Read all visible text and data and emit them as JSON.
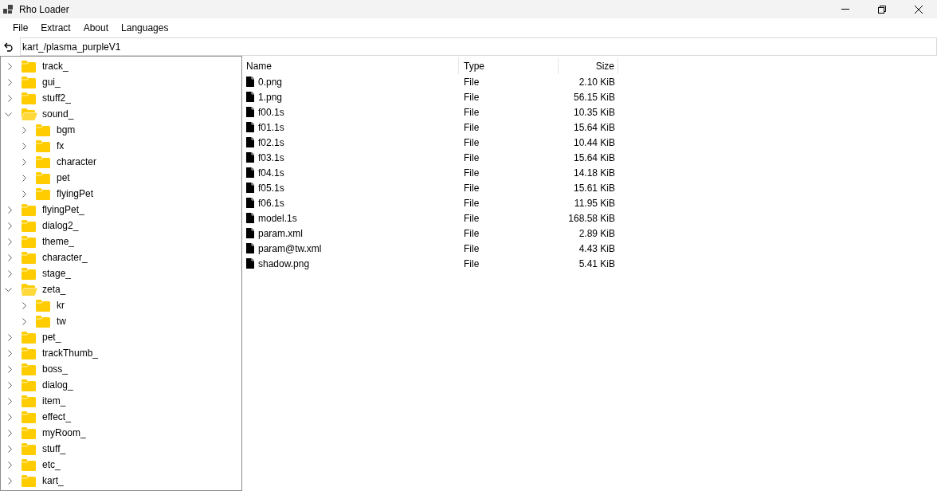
{
  "window": {
    "title": "Rho Loader"
  },
  "menu": [
    "File",
    "Extract",
    "About",
    "Languages"
  ],
  "path_field": {
    "value": "kart_/plasma_purpleV1"
  },
  "tree": [
    {
      "label": "track_",
      "expanded": false
    },
    {
      "label": "gui_",
      "expanded": false
    },
    {
      "label": "stuff2_",
      "expanded": false
    },
    {
      "label": "sound_",
      "expanded": true,
      "children": [
        {
          "label": "bgm",
          "expanded": false
        },
        {
          "label": "fx",
          "expanded": false
        },
        {
          "label": "character",
          "expanded": false
        },
        {
          "label": "pet",
          "expanded": false
        },
        {
          "label": "flyingPet",
          "expanded": false
        }
      ]
    },
    {
      "label": "flyingPet_",
      "expanded": false
    },
    {
      "label": "dialog2_",
      "expanded": false
    },
    {
      "label": "theme_",
      "expanded": false
    },
    {
      "label": "character_",
      "expanded": false
    },
    {
      "label": "stage_",
      "expanded": false
    },
    {
      "label": "zeta_",
      "expanded": true,
      "children": [
        {
          "label": "kr",
          "expanded": false
        },
        {
          "label": "tw",
          "expanded": false
        }
      ]
    },
    {
      "label": "pet_",
      "expanded": false
    },
    {
      "label": "trackThumb_",
      "expanded": false
    },
    {
      "label": "boss_",
      "expanded": false
    },
    {
      "label": "dialog_",
      "expanded": false
    },
    {
      "label": "item_",
      "expanded": false
    },
    {
      "label": "effect_",
      "expanded": false
    },
    {
      "label": "myRoom_",
      "expanded": false
    },
    {
      "label": "stuff_",
      "expanded": false
    },
    {
      "label": "etc_",
      "expanded": false
    },
    {
      "label": "kart_",
      "expanded": false
    }
  ],
  "table": {
    "columns": [
      "Name",
      "Type",
      "Size"
    ],
    "rows": [
      [
        "0.png",
        "File",
        "2.10 KiB"
      ],
      [
        "1.png",
        "File",
        "56.15 KiB"
      ],
      [
        "f00.1s",
        "File",
        "10.35 KiB"
      ],
      [
        "f01.1s",
        "File",
        "15.64 KiB"
      ],
      [
        "f02.1s",
        "File",
        "10.44 KiB"
      ],
      [
        "f03.1s",
        "File",
        "15.64 KiB"
      ],
      [
        "f04.1s",
        "File",
        "14.18 KiB"
      ],
      [
        "f05.1s",
        "File",
        "15.61 KiB"
      ],
      [
        "f06.1s",
        "File",
        "11.95 KiB"
      ],
      [
        "model.1s",
        "File",
        "168.58 KiB"
      ],
      [
        "param.xml",
        "File",
        "2.89 KiB"
      ],
      [
        "param@tw.xml",
        "File",
        "4.43 KiB"
      ],
      [
        "shadow.png",
        "File",
        "5.41 KiB"
      ]
    ]
  }
}
